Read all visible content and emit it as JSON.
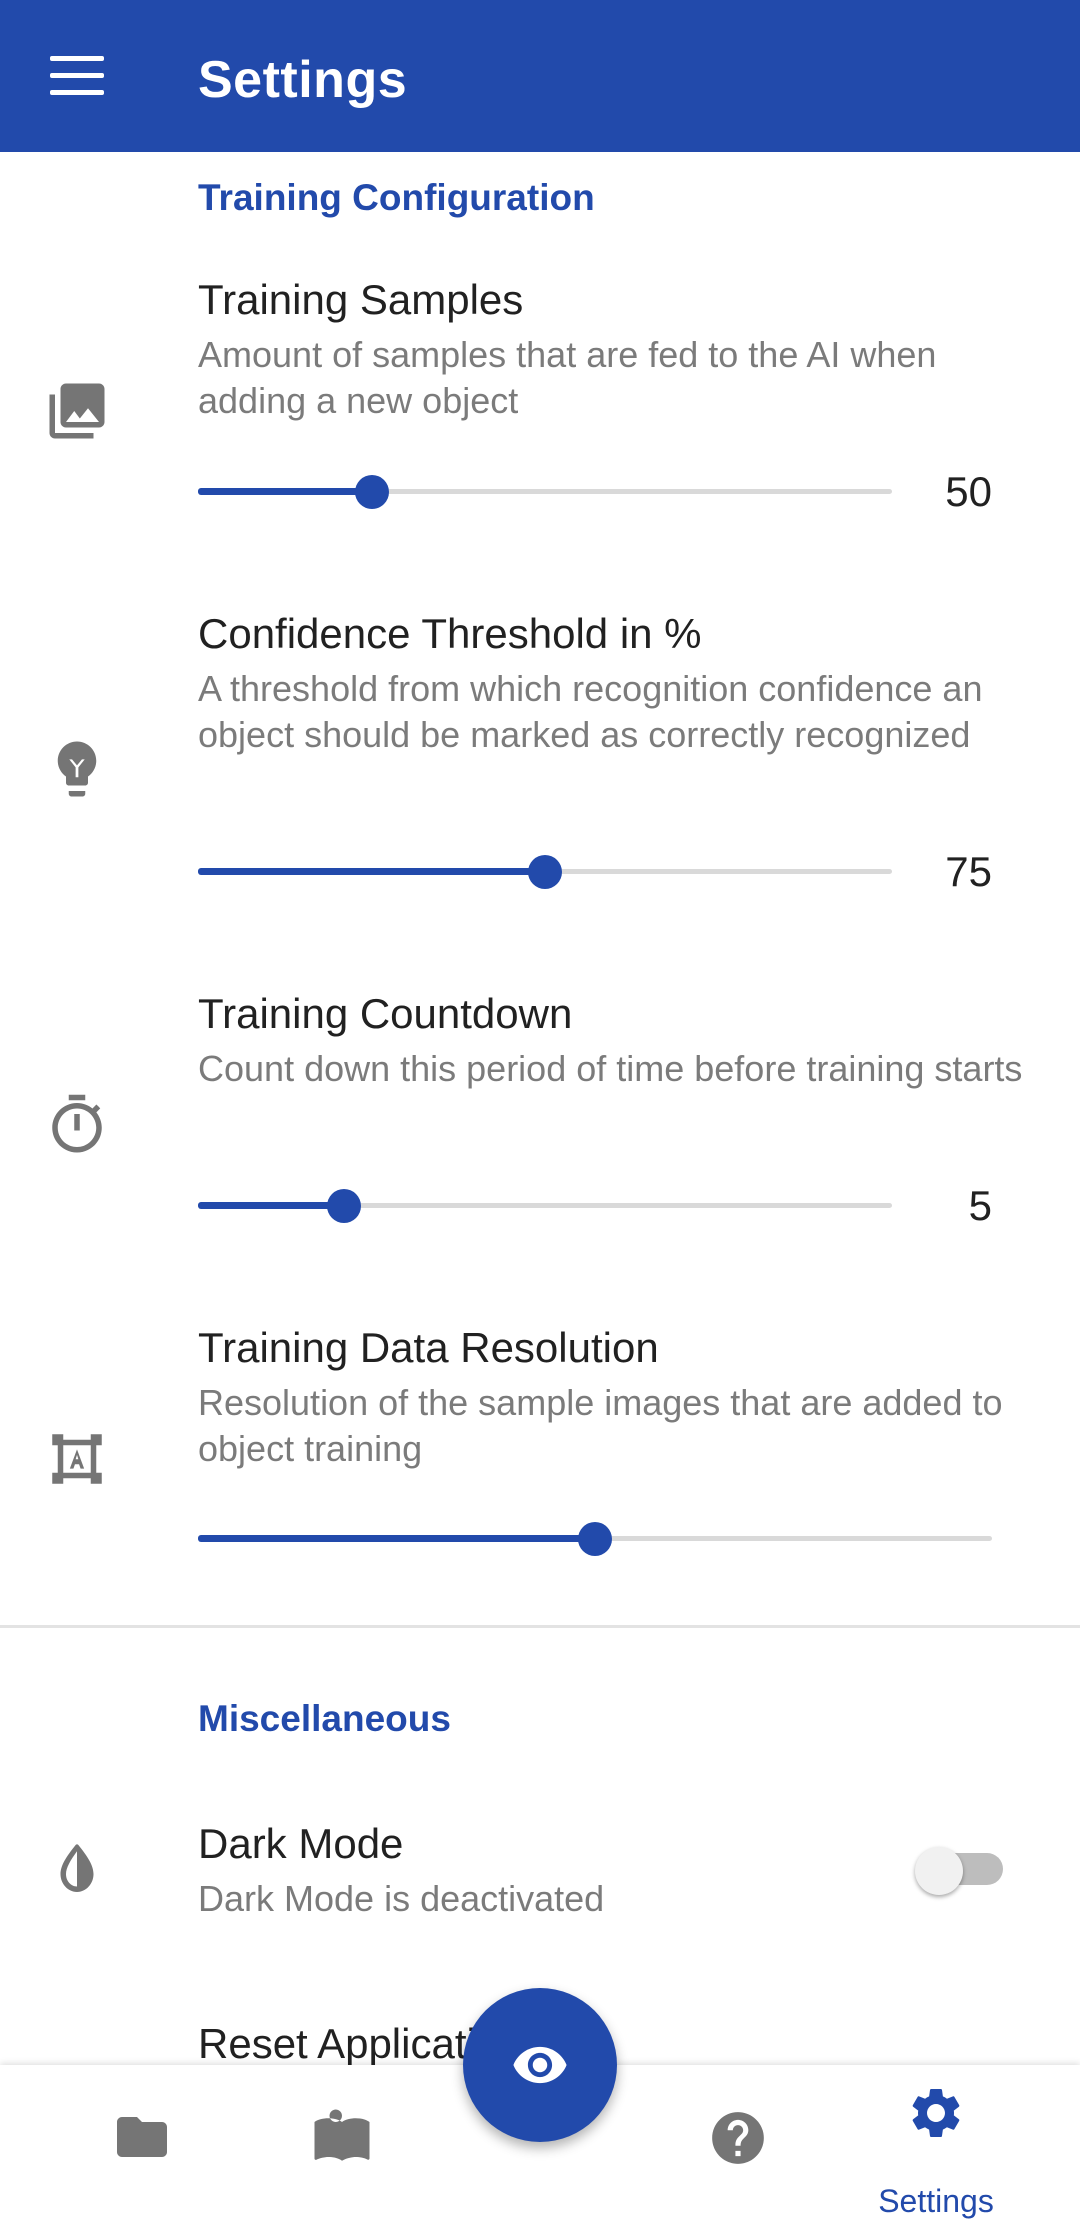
{
  "appbar": {
    "title": "Settings"
  },
  "sections": {
    "training": "Training Configuration",
    "misc": "Miscellaneous"
  },
  "prefs": {
    "samples": {
      "title": "Training Samples",
      "summary": "Amount of samples that are fed to the AI when adding a new object",
      "value": "50",
      "slider_fraction": 0.25
    },
    "confidence": {
      "title": "Confidence Threshold in %",
      "summary": "A threshold from which recognition confidence an object should be marked as correctly recognized",
      "value": "75",
      "slider_fraction": 0.5
    },
    "countdown": {
      "title": "Training Countdown",
      "summary": "Count down this period of time before training starts",
      "value": "5",
      "slider_fraction": 0.21
    },
    "resolution": {
      "title": "Training Data Resolution",
      "summary": "Resolution of the sample images that are added to object training",
      "slider_fraction": 0.5
    },
    "darkmode": {
      "title": "Dark Mode",
      "summary": "Dark Mode is deactivated",
      "enabled": false
    },
    "reset": {
      "title": "Reset Application"
    }
  },
  "bottom_nav": {
    "items": [
      {
        "icon": "folder-icon"
      },
      {
        "icon": "book-icon"
      },
      {
        "icon": "help-icon"
      },
      {
        "icon": "gear-icon",
        "label": "Settings",
        "active": true
      }
    ],
    "fab_icon": "eye-icon"
  },
  "colors": {
    "primary": "#224aab",
    "text": "#212121",
    "secondary_text": "#7b7b7b"
  }
}
